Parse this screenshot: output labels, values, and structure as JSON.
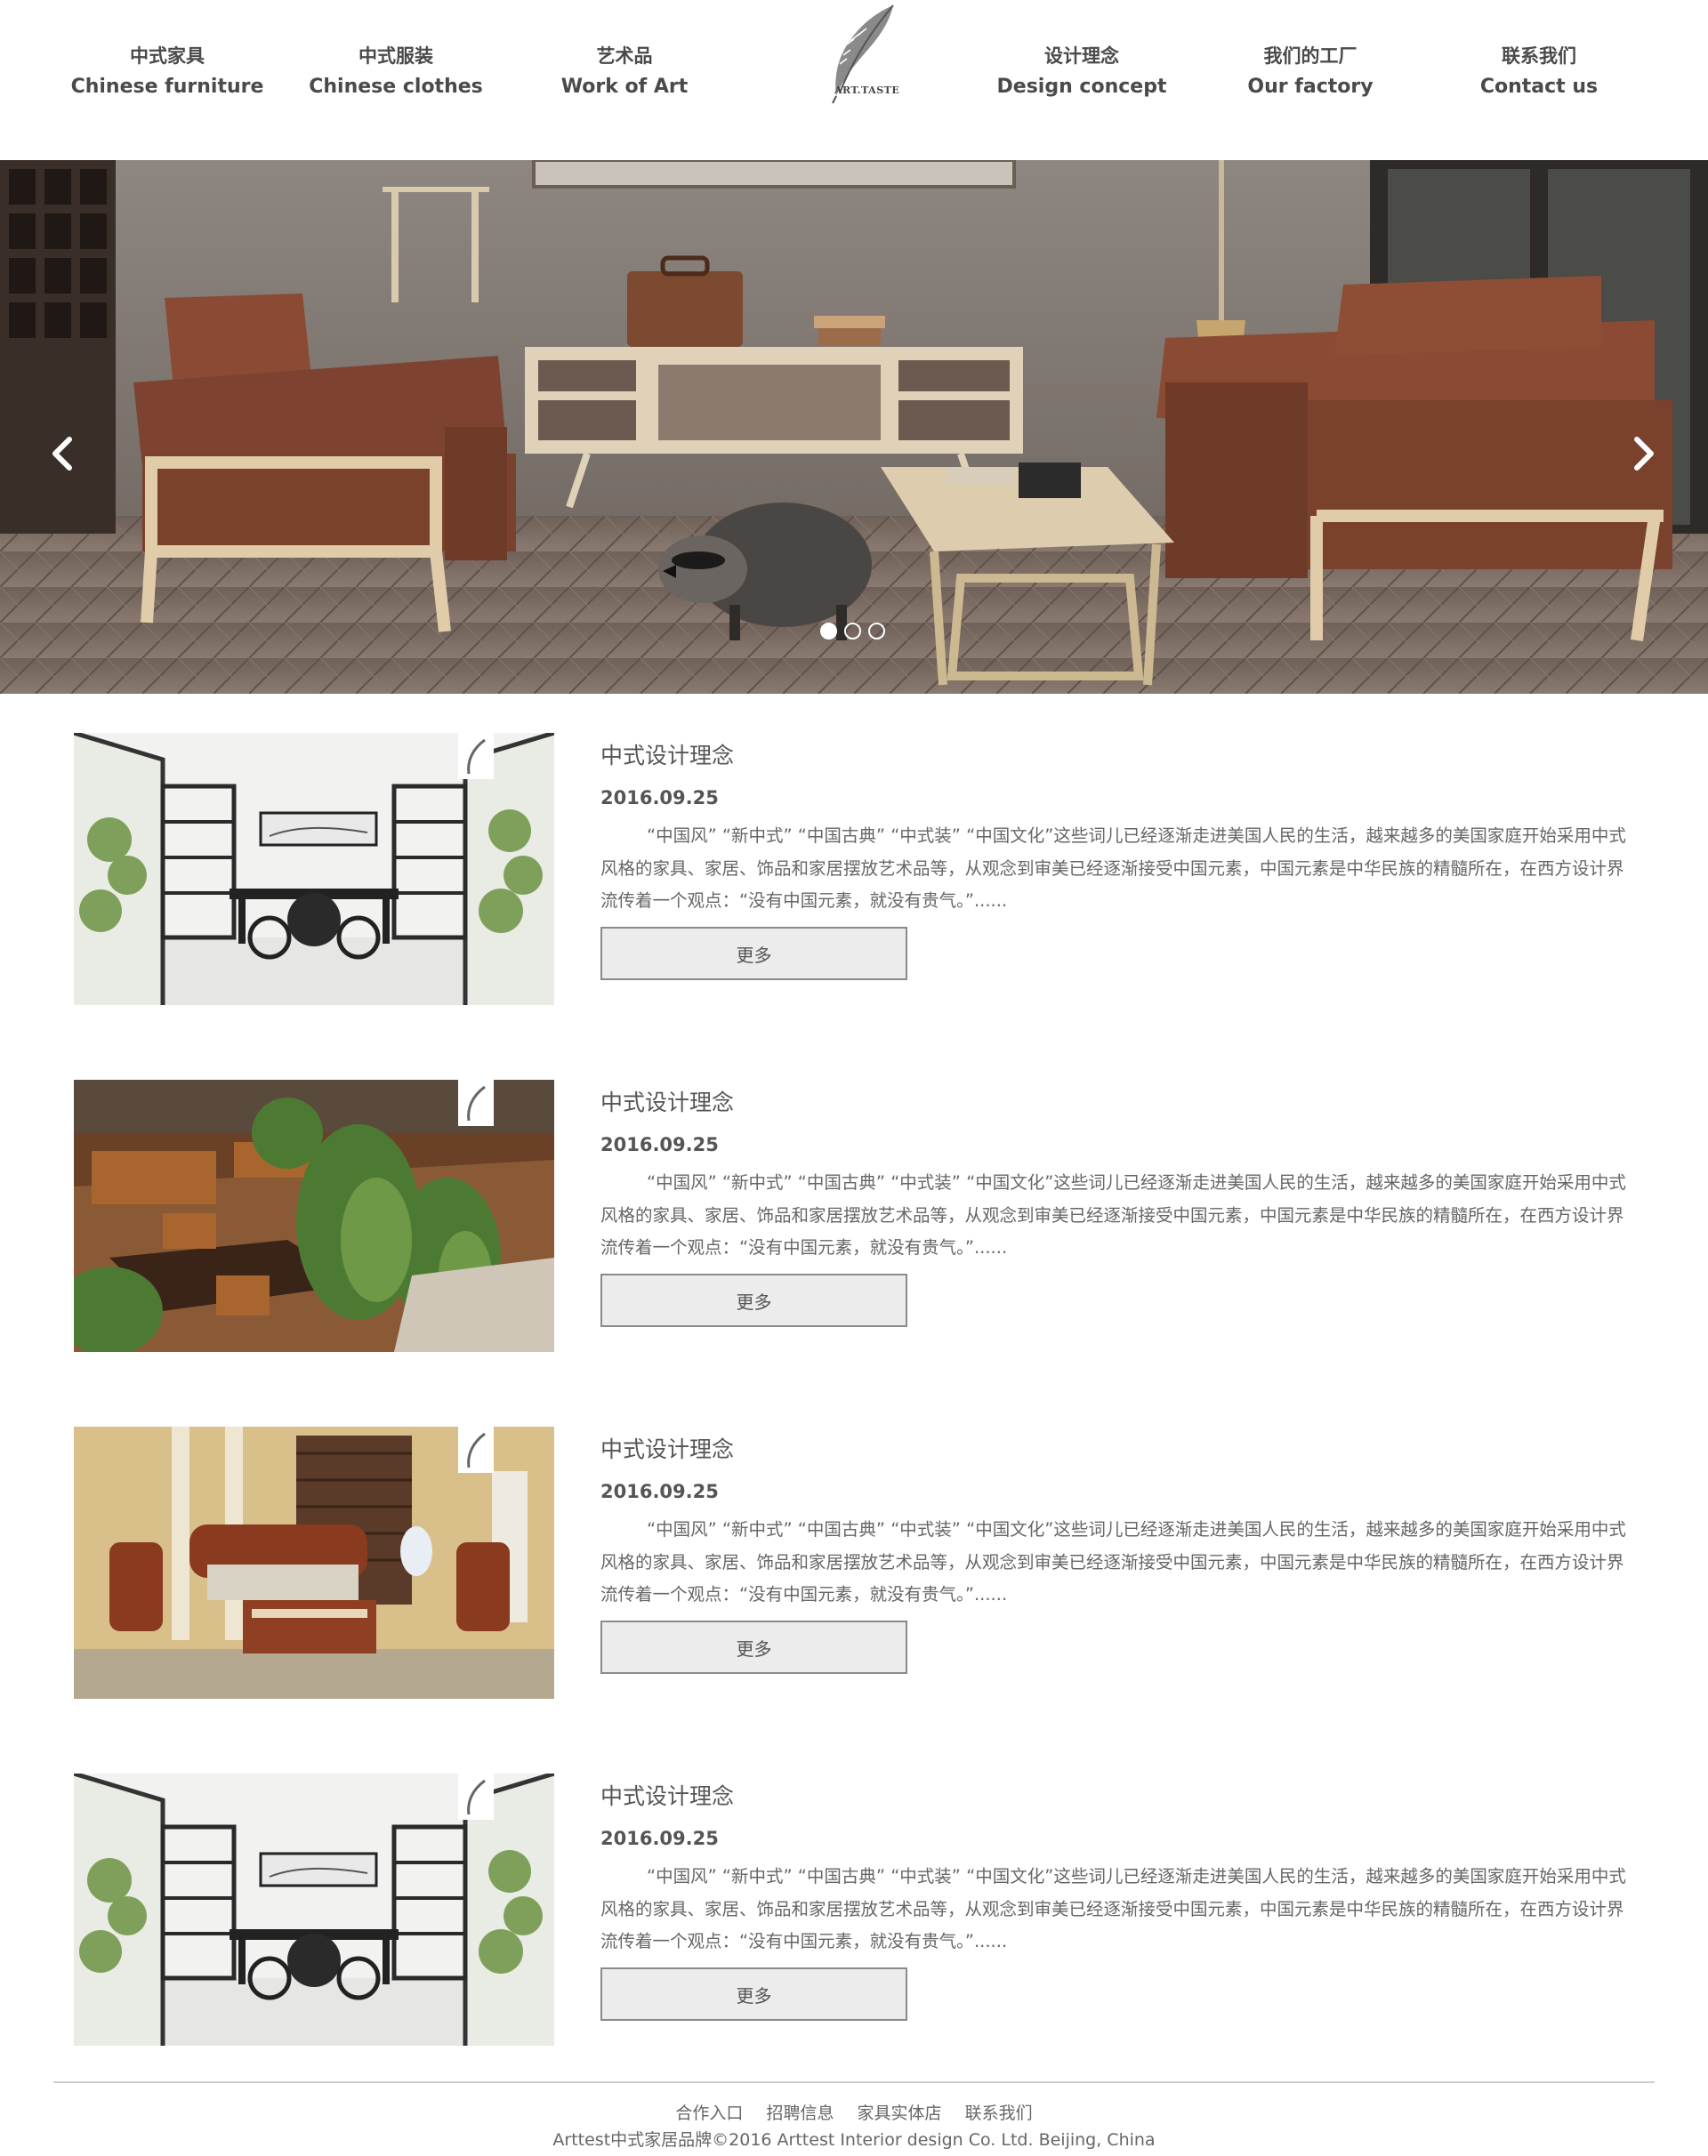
{
  "nav": {
    "left": [
      {
        "zh": "中式家具",
        "en": "Chinese furniture"
      },
      {
        "zh": "中式服装",
        "en": "Chinese clothes"
      },
      {
        "zh": "艺术品",
        "en": "Work of Art"
      }
    ],
    "right": [
      {
        "zh": "设计理念",
        "en": "Design concept"
      },
      {
        "zh": "我们的工厂",
        "en": "Our factory"
      },
      {
        "zh": "联系我们",
        "en": "Contact us"
      }
    ],
    "logo_text": "ART.TASTE"
  },
  "banner": {
    "slide_count": 3,
    "active_slide": 1,
    "prev_icon": "chevron-left-icon",
    "next_icon": "chevron-right-icon"
  },
  "articles": [
    {
      "title": "中式设计理念",
      "date": "2016.09.25",
      "body": "“中国风” “新中式” “中国古典” “中式装” “中国文化”这些词儿已经逐渐走进美国人民的生活，越来越多的美国家庭开始采用中式风格的家具、家居、饰品和家居摆放艺术品等，从观念到审美已经逐渐接受中国元素，中国元素是中华民族的精髓所在，在西方设计界流传着一个观点：“没有中国元素，就没有贵气。”......",
      "more": "更多"
    },
    {
      "title": "中式设计理念",
      "date": "2016.09.25",
      "body": "“中国风” “新中式” “中国古典” “中式装” “中国文化”这些词儿已经逐渐走进美国人民的生活，越来越多的美国家庭开始采用中式风格的家具、家居、饰品和家居摆放艺术品等，从观念到审美已经逐渐接受中国元素，中国元素是中华民族的精髓所在，在西方设计界流传着一个观点：“没有中国元素，就没有贵气。”......",
      "more": "更多"
    },
    {
      "title": "中式设计理念",
      "date": "2016.09.25",
      "body": "“中国风” “新中式” “中国古典” “中式装” “中国文化”这些词儿已经逐渐走进美国人民的生活，越来越多的美国家庭开始采用中式风格的家具、家居、饰品和家居摆放艺术品等，从观念到审美已经逐渐接受中国元素，中国元素是中华民族的精髓所在，在西方设计界流传着一个观点：“没有中国元素，就没有贵气。”......",
      "more": "更多"
    },
    {
      "title": "中式设计理念",
      "date": "2016.09.25",
      "body": "“中国风” “新中式” “中国古典” “中式装” “中国文化”这些词儿已经逐渐走进美国人民的生活，越来越多的美国家庭开始采用中式风格的家具、家居、饰品和家居摆放艺术品等，从观念到审美已经逐渐接受中国元素，中国元素是中华民族的精髓所在，在西方设计界流传着一个观点：“没有中国元素，就没有贵气。”......",
      "more": "更多"
    }
  ],
  "footer": {
    "links": [
      "合作入口",
      "招聘信息",
      "家具实体店",
      "联系我们"
    ],
    "copyright": "Arttest中式家居品牌©2016 Arttest Interior design Co. Ltd. Beijing, China"
  },
  "colors": {
    "nav_text": "#4a4a4a",
    "body_text": "#666666",
    "button_bg": "#ececec",
    "button_border": "#8a8a8a",
    "footer_rule": "#cfcfcf"
  }
}
